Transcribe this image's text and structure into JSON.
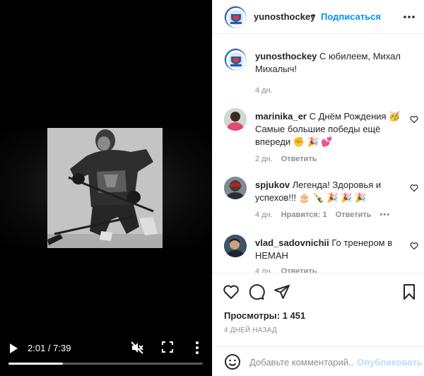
{
  "video": {
    "current_time": "2:01",
    "separator": " / ",
    "duration": "7:39",
    "progress_fraction": 0.28,
    "play_icon": "play-icon",
    "mute_icon": "muted-speaker-icon",
    "fullscreen_icon": "fullscreen-icon",
    "more_icon": "more-vertical-icon"
  },
  "header": {
    "username": "yunosthockey",
    "dot": "•",
    "follow_label": "Подписаться",
    "more_icon": "more-horizontal-icon"
  },
  "caption": {
    "username": "yunosthockey",
    "text": "С юбилеем, Михал Михалыч!",
    "time": "4 дн."
  },
  "comments": [
    {
      "username": "marinika_er",
      "text": "С Днём Рождения 🥳 Самые большие победы ещё впереди ✊ 🎉 💕",
      "time": "2 дн.",
      "likes": "",
      "reply": "Ответить"
    },
    {
      "username": "spjukov",
      "text": "Легенда! Здоровья и успехов!!! 🎂 🍾 🎉 🎉 🎉",
      "time": "4 дн.",
      "likes": "Нравится: 1",
      "reply": "Ответить"
    },
    {
      "username": "vlad_sadovnichii",
      "text": "Го тренером в НЕМАН",
      "time": "4 дн.",
      "likes": "",
      "reply": "Ответить"
    }
  ],
  "actions": {
    "views_label": "Просмотры:",
    "views_count": "1 451",
    "date": "4 ДНЕЙ НАЗАД"
  },
  "add_comment": {
    "placeholder": "Добавьте комментарий...",
    "publish_label": "Опубликовать"
  },
  "colors": {
    "link_blue": "#0095f6",
    "publish_disabled": "#b2dffc",
    "secondary_text": "#8e8e8e"
  }
}
